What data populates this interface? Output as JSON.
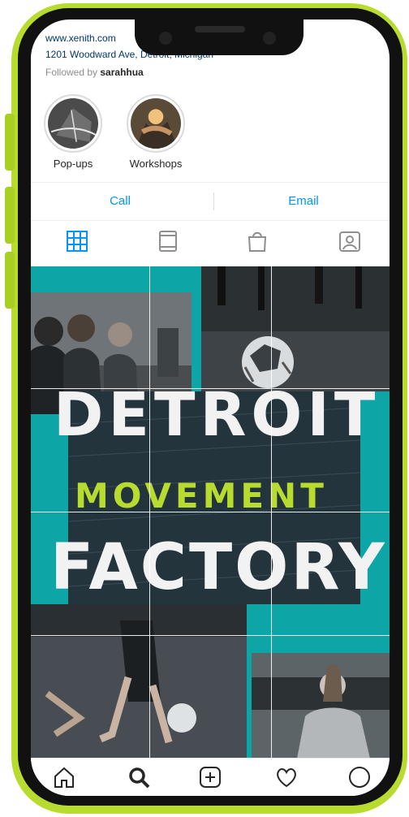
{
  "profile": {
    "website": "www.xenith.com",
    "address": "1201 Woodward Ave, Detroit, Michigan",
    "followed_prefix": "Followed by",
    "followed_user": "sarahhua"
  },
  "highlights": [
    {
      "label": "Pop-ups"
    },
    {
      "label": "Workshops"
    }
  ],
  "actions": {
    "call": "Call",
    "email": "Email"
  },
  "tabs": [
    "grid-icon",
    "igtv-icon",
    "shop-icon",
    "tagged-icon"
  ],
  "post": {
    "line1": "DETROIT",
    "line2": "MOVEMENT",
    "line3": "FACTORY"
  },
  "bottom_nav": [
    "home-icon",
    "search-icon",
    "add-icon",
    "heart-icon",
    "profile-icon"
  ],
  "colors": {
    "accent": "#0095f6",
    "teal": "#0ea5a6",
    "lime": "#b7dc2f",
    "title_bg": "#24343d"
  }
}
